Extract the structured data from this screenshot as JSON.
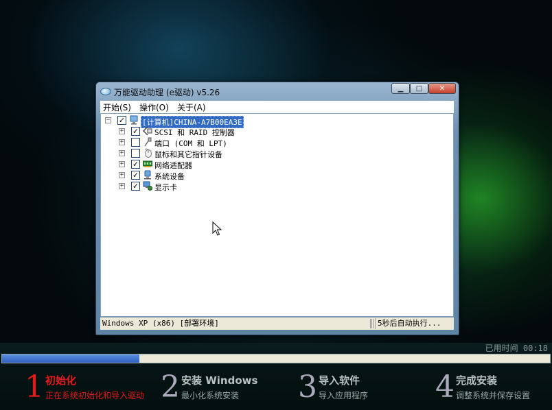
{
  "window": {
    "title": "万能驱动助理 (e驱动) v5.26",
    "menu": [
      {
        "label": "开始(S)"
      },
      {
        "label": "操作(O)"
      },
      {
        "label": "关于(A)"
      }
    ],
    "tree": {
      "root": {
        "label": "[计算机]CHINA-A7B00EA3E",
        "checked": true,
        "expander": "−"
      },
      "children": [
        {
          "label": "SCSI 和 RAID 控制器",
          "checked": true,
          "icon": "scsi-icon",
          "expander": "+"
        },
        {
          "label": "端口 (COM 和 LPT)",
          "checked": false,
          "icon": "port-icon",
          "expander": "+"
        },
        {
          "label": "鼠标和其它指针设备",
          "checked": false,
          "icon": "mouse-icon",
          "expander": "+"
        },
        {
          "label": "网络适配器",
          "checked": true,
          "icon": "network-icon",
          "expander": "+"
        },
        {
          "label": "系统设备",
          "checked": true,
          "icon": "system-icon",
          "expander": "+"
        },
        {
          "label": "显示卡",
          "checked": true,
          "icon": "display-icon",
          "expander": "+"
        }
      ]
    },
    "status": {
      "left": "Windows XP (x86) [部署环境]",
      "right": "5秒后自动执行..."
    }
  },
  "time_label": "已用时间 00:18",
  "progress": 0.25,
  "steps": [
    {
      "number": "1",
      "title": "初始化",
      "subtitle": "正在系统初始化和导入驱动",
      "active": true
    },
    {
      "number": "2",
      "title": "安装 Windows",
      "subtitle": "最小化系统安装",
      "active": false
    },
    {
      "number": "3",
      "title": "导入软件",
      "subtitle": "导入应用程序",
      "active": false
    },
    {
      "number": "4",
      "title": "完成安装",
      "subtitle": "调整系统并保存设置",
      "active": false
    }
  ],
  "colors": {
    "accent_red": "#e21b1b",
    "progress_blue": "#2f62c0",
    "selection_blue": "#316ac5"
  }
}
